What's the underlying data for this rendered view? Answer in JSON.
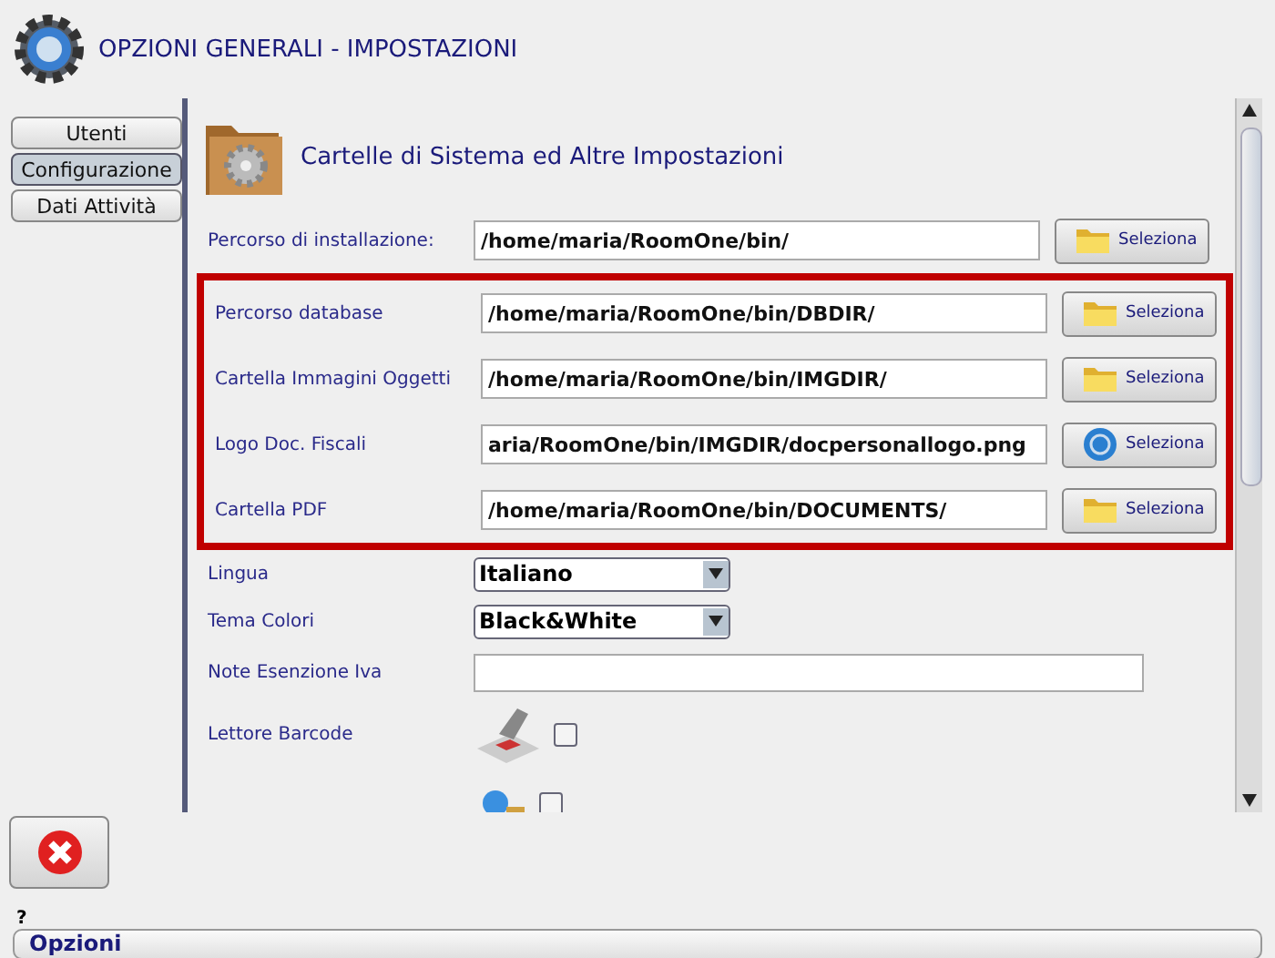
{
  "window": {
    "title": "OPZIONI GENERALI - IMPOSTAZIONI"
  },
  "sidebar": {
    "items": [
      {
        "label": "Utenti",
        "selected": false
      },
      {
        "label": "Configurazione",
        "selected": true
      },
      {
        "label": "Dati Attività",
        "selected": false
      }
    ]
  },
  "section": {
    "title": "Cartelle di Sistema ed Altre Impostazioni"
  },
  "rows": [
    {
      "kind": "path",
      "label": "Percorso di installazione:",
      "value": "/home/maria/RoomOne/bin/",
      "button": {
        "label": "Seleziona",
        "kind": "folder"
      },
      "highlighted": false
    },
    {
      "kind": "path",
      "label": "Percorso database",
      "value": "/home/maria/RoomOne/bin/DBDIR/",
      "button": {
        "label": "Seleziona",
        "kind": "folder"
      },
      "highlighted": true
    },
    {
      "kind": "path",
      "label": "Cartella Immagini Oggetti",
      "value": "/home/maria/RoomOne/bin/IMGDIR/",
      "button": {
        "label": "Seleziona",
        "kind": "folder"
      },
      "highlighted": true
    },
    {
      "kind": "path",
      "label": "Logo Doc. Fiscali",
      "value": "aria/RoomOne/bin/IMGDIR/docpersonallogo.png",
      "button": {
        "label": "Seleziona",
        "kind": "logo"
      },
      "highlighted": true
    },
    {
      "kind": "path",
      "label": "Cartella PDF",
      "value": "/home/maria/RoomOne/bin/DOCUMENTS/",
      "button": {
        "label": "Seleziona",
        "kind": "folder"
      },
      "highlighted": true
    },
    {
      "kind": "select",
      "label": "Lingua",
      "value": "Italiano",
      "highlighted": false
    },
    {
      "kind": "select",
      "label": "Tema Colori",
      "value": "Black&White",
      "highlighted": false
    },
    {
      "kind": "text",
      "label": "Note Esenzione Iva",
      "highlighted": false
    },
    {
      "kind": "check",
      "label": "Lettore Barcode",
      "checked": false,
      "highlighted": false
    },
    {
      "kind": "check",
      "checked": false,
      "highlighted": false
    }
  ],
  "help": "?",
  "status_bar": {
    "text": "Opzioni"
  }
}
